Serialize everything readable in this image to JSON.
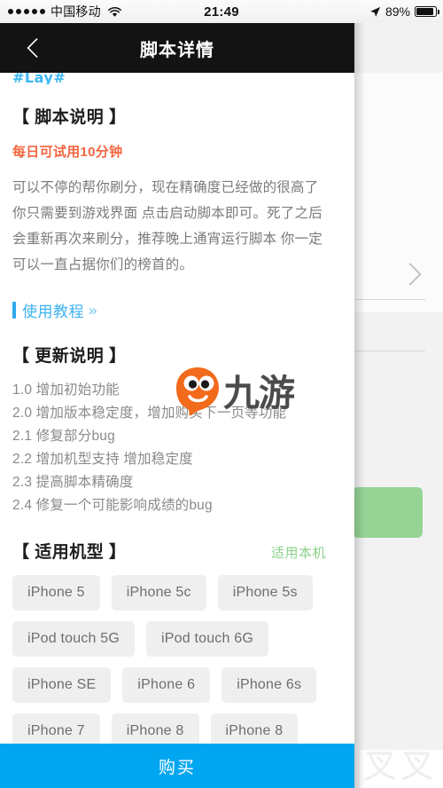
{
  "status_bar": {
    "signal_dots": 5,
    "carrier": "中国移动",
    "wifi_icon": "wifi-icon",
    "time": "21:49",
    "location_icon": "location-arrow-icon",
    "battery_percent": "89%",
    "battery_level": 89
  },
  "navbar": {
    "back_icon": "chevron-left-icon",
    "title": "脚本详情"
  },
  "content": {
    "clipped_tag": "#Lay#",
    "script_desc_title": "【 脚本说明 】",
    "trial_note": "每日可试用10分钟",
    "description_lines": [
      "可以不停的帮你刷分，现在精确度已经做的很高了",
      "你只需要到游戏界面 点击启动脚本即可。死了之后",
      "会重新再次来刷分，推荐晚上通宵运行脚本 你一定",
      "可以一直占据你们的榜首的。"
    ],
    "tutorial_link": "使用教程",
    "tutorial_chevron": "»",
    "update_title": "【 更新说明 】",
    "update_lines": [
      "1.0 增加初始功能",
      "2.0 增加版本稳定度，增加购买下一页等功能",
      "2.1 修复部分bug",
      "2.2 增加机型支持 增加稳定度",
      "2.3 提高脚本精确度",
      "2.4 修复一个可能影响成绩的bug"
    ],
    "models_title": "【 适用机型 】",
    "models_badge": "适用本机",
    "models": [
      "iPhone 5",
      "iPhone 5c",
      "iPhone 5s",
      "iPod touch 5G",
      "iPod touch 6G",
      "iPhone SE",
      "iPhone 6",
      "iPhone 6s",
      "iPhone 7",
      "iPhone 8",
      "iPhone 8",
      "",
      ""
    ]
  },
  "watermark": {
    "logo_text": "九游",
    "logo_icon": "jiuyou-mascot-icon",
    "corner_text": "叉叉"
  },
  "bottom_bar": {
    "buy_label": "购买"
  },
  "colors": {
    "accent_blue": "#00a6f0",
    "link_blue": "#3cb3f0",
    "trial_orange": "#f4653f",
    "badge_green": "#8cd18c",
    "navbar_black": "#131313",
    "chip_bg": "#efefef",
    "bg_green_button": "#96d496"
  }
}
